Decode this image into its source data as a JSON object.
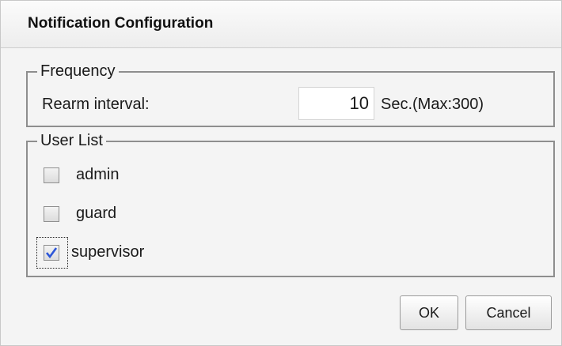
{
  "dialog": {
    "title": "Notification Configuration"
  },
  "frequency": {
    "legend": "Frequency",
    "rearm_label": "Rearm interval:",
    "rearm_value": "10",
    "rearm_unit": "Sec.(Max:300)"
  },
  "user_list": {
    "legend": "User List",
    "users": [
      {
        "name": "admin",
        "checked": false
      },
      {
        "name": "guard",
        "checked": false
      },
      {
        "name": "supervisor",
        "checked": true
      }
    ]
  },
  "buttons": {
    "ok_label": "OK",
    "cancel_label": "Cancel"
  },
  "colors": {
    "checkmark": "#2b55d8",
    "frame": "#8e8e8e"
  }
}
